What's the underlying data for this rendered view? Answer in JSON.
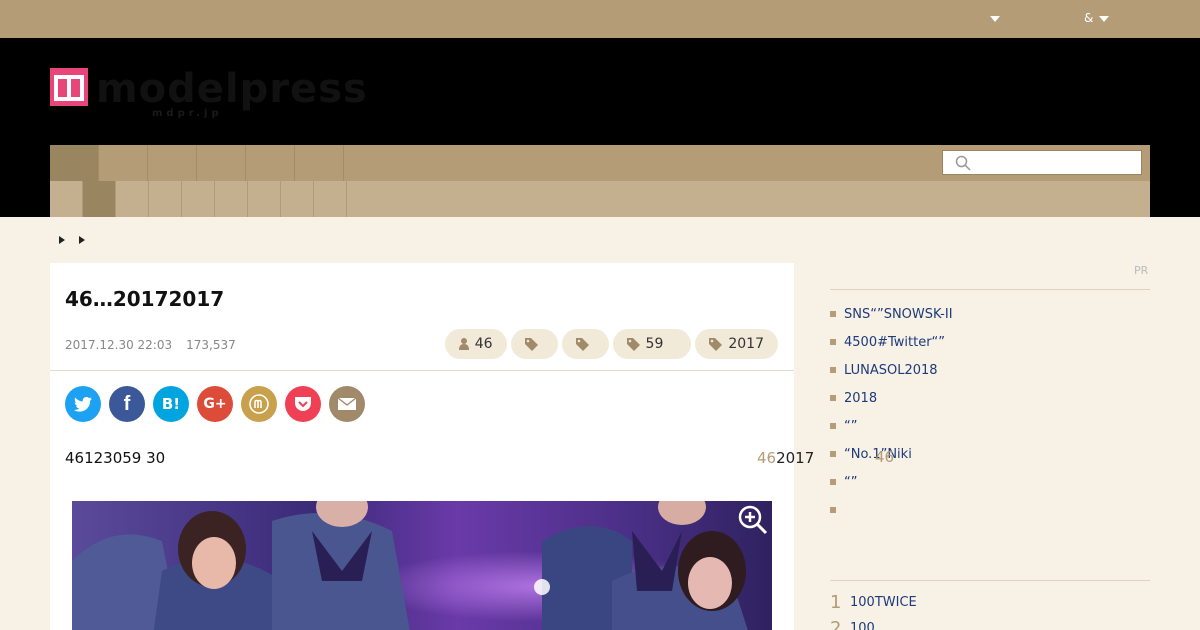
{
  "topbar": {
    "menu_1": "",
    "menu_2": "&"
  },
  "logo": {
    "text": "modelpress",
    "sub": "mdpr.jp"
  },
  "search": {
    "placeholder": ""
  },
  "article": {
    "title": "46…20172017",
    "date": "2017.12.30 22:03",
    "views": "173,537",
    "tags": [
      {
        "icon": "person-icon",
        "label": "46"
      },
      {
        "icon": "tag-icon",
        "label": ""
      },
      {
        "icon": "tag-icon",
        "label": ""
      },
      {
        "icon": "tag-icon",
        "label": "59"
      },
      {
        "icon": "tag-icon",
        "label": "2017"
      }
    ],
    "lead": "46123059 30",
    "inline_gold": "46",
    "inline_black": "2017"
  },
  "share": [
    {
      "name": "twitter-share-button",
      "glyph": "t",
      "color": "#1da1f2"
    },
    {
      "name": "facebook-share-button",
      "glyph": "f",
      "color": "#3b5998"
    },
    {
      "name": "hatena-share-button",
      "glyph": "B!",
      "color": "#00a4de"
    },
    {
      "name": "googleplus-share-button",
      "glyph": "G+",
      "color": "#dd4b39"
    },
    {
      "name": "modelpress-share-button",
      "glyph": "m",
      "color": "#c9a04c"
    },
    {
      "name": "pocket-share-button",
      "glyph": "p",
      "color": "#ef4056"
    },
    {
      "name": "mail-share-button",
      "glyph": "✉",
      "color": "#a08a6a"
    }
  ],
  "sidebar": {
    "pr_label": "PR",
    "links": [
      "SNS“”SNOWSK-II",
      "4500#Twitter“”",
      "LUNASOL2018",
      "2018",
      "“”",
      "“No.1”Niki",
      "“”",
      ""
    ],
    "note": "46",
    "ranking": [
      {
        "num": "1",
        "label": "100TWICE"
      },
      {
        "num": "2",
        "label": "100"
      }
    ]
  },
  "colors": {
    "gold": "#b39c76",
    "pink": "#e8457a",
    "link": "#1d3b7a"
  }
}
